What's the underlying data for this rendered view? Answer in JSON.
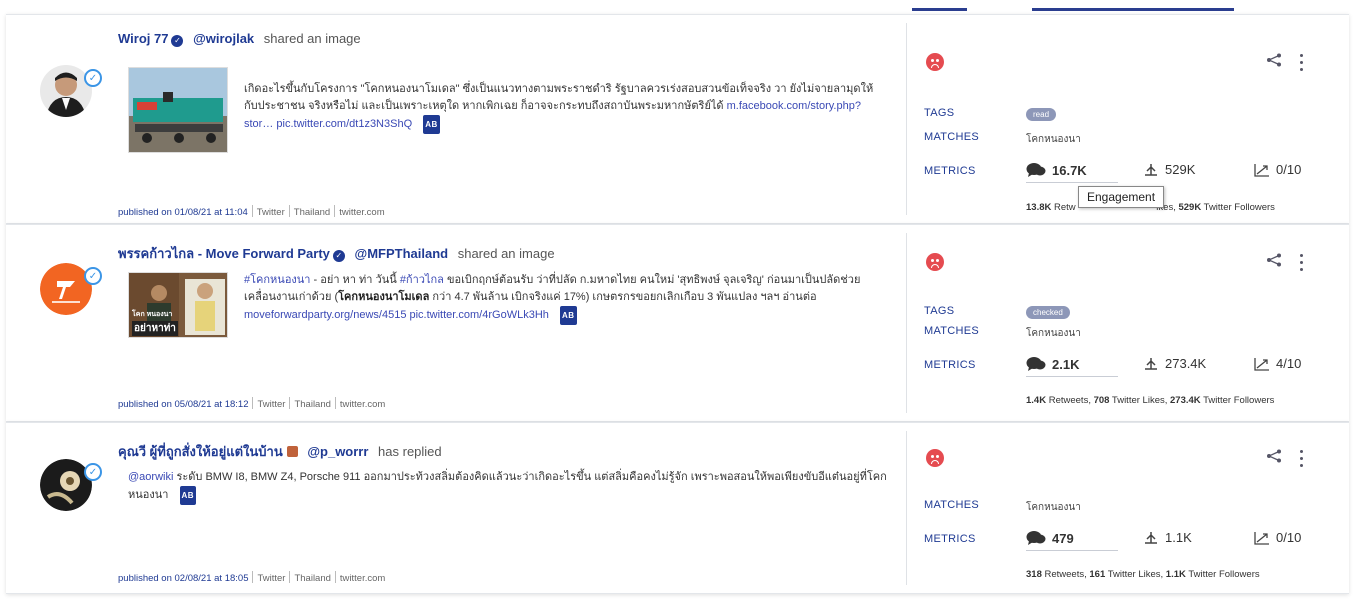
{
  "posts": [
    {
      "author": "Wiroj 77",
      "handle": "@wirojlak",
      "action": "shared an image",
      "text": "เกิดอะไรขึ้นกับโครงการ \"โคกหนองนาโมเดล\" ซึ่งเป็นแนวทางตามพระราชดำริ รัฐบาลควรเร่งสอบสวนข้อเท็จจริง วา ยังไม่จายลามุดให้กับประชาชน จริงหรือไม่ และเป็นเพราะเหตุใด หากเพิกเฉย ก็อาจจะกระทบถึงสถาบันพระมหากษัตริย์ได้",
      "link1": "m.facebook.com/story.php?stor…",
      "link2": "pic.twitter.com/dt1z3N3ShQ",
      "translate_badge": "AB",
      "published": "published on 01/08/21 at 11:04",
      "source": "Twitter",
      "country": "Thailand",
      "domain": "twitter.com",
      "tag": "read",
      "tags_label": "TAGS",
      "matches_label": "MATCHES",
      "matches": "โคกหนองนา",
      "metrics_label": "METRICS",
      "engagement": "16.7K",
      "reach": "529K",
      "score": "0/10",
      "summary_pre": "13.8K",
      "summary_mid": " Retw",
      "summary_post_bold": "529K",
      "summary_post": " Twitter Followers",
      "summary_likes_fragment": "ikes, "
    },
    {
      "author": "พรรคก้าวไกล - Move Forward Party",
      "handle": "@MFPThailand",
      "action": "shared an image",
      "hashtag1": "#โคกหนองนา",
      "text_a": " - อย่า หา ท่า วันนี้ ",
      "hashtag2": "#ก้าวไกล",
      "text_b": " ขอเบิกฤกษ์ต้อนรับ ว่าที่ปลัด ก.มหาดไทย คนใหม่ 'สุทธิพงษ์ จุลเจริญ' ก่อนมาเป็นปลัดช่วยเคลื่อนงานเก่าด้วย (",
      "bold_text": "โคกหนองนาโมเดล",
      "text_c": " กว่า 4.7 พันล้าน เบิกจริงแค่ 17%) เกษตรกรขอยกเลิกเกือบ 3 พันแปลง ฯลฯ อ่านต่อ",
      "link1": "moveforwardparty.org/news/4515",
      "link2": "pic.twitter.com/4rGoWLk3Hh",
      "translate_badge": "AB",
      "published": "published on 05/08/21 at 18:12",
      "source": "Twitter",
      "country": "Thailand",
      "domain": "twitter.com",
      "tag": "checked",
      "tags_label": "TAGS",
      "matches_label": "MATCHES",
      "matches": "โคกหนองนา",
      "metrics_label": "METRICS",
      "engagement": "2.1K",
      "reach": "273.4K",
      "score": "4/10",
      "summary_a": "1.4K",
      "summary_b": " Retweets, ",
      "summary_c": "708",
      "summary_d": " Twitter Likes, ",
      "summary_e": "273.4K",
      "summary_f": " Twitter Followers",
      "thumb_caption_1": "โคก หนองนา",
      "thumb_caption_2": "อย่าหาท่า"
    },
    {
      "author": "คุณวี ผู้ที่ถูกสั่งให้อยู่แต่ในบ้าน",
      "handle": "@p_worrr",
      "action": "has replied",
      "mention": "@aorwiki",
      "text": " ระดับ BMW I8, BMW Z4, Porsche 911 ออกมาประท้วงสลิ่มต้องคิดแล้วนะว่าเกิดอะไรขึ้น แต่สลิ่มคือคงไม่รู้จัก เพราะพอสอนให้พอเพียงขับอีแต๋นอยู่ที่โคกหนองนา",
      "translate_badge": "AB",
      "published": "published on 02/08/21 at 18:05",
      "source": "Twitter",
      "country": "Thailand",
      "domain": "twitter.com",
      "matches_label": "MATCHES",
      "matches": "โคกหนองนา",
      "metrics_label": "METRICS",
      "engagement": "479",
      "reach": "1.1K",
      "score": "0/10",
      "summary_a": "318",
      "summary_b": " Retweets, ",
      "summary_c": "161",
      "summary_d": " Twitter Likes, ",
      "summary_e": "1.1K",
      "summary_f": " Twitter Followers"
    }
  ],
  "tooltip": {
    "text": "Engagement"
  },
  "colors": {
    "accent": "#1f3a93",
    "negative": "#e54b50",
    "chip": "#8d97b8"
  },
  "icons": {
    "sentiment": "frown-face-icon",
    "share": "share-icon",
    "more": "more-vertical-icon",
    "engagement": "chat-bubbles-icon",
    "reach": "reach-icon",
    "score": "trend-up-icon",
    "verified": "verified-check-icon"
  }
}
